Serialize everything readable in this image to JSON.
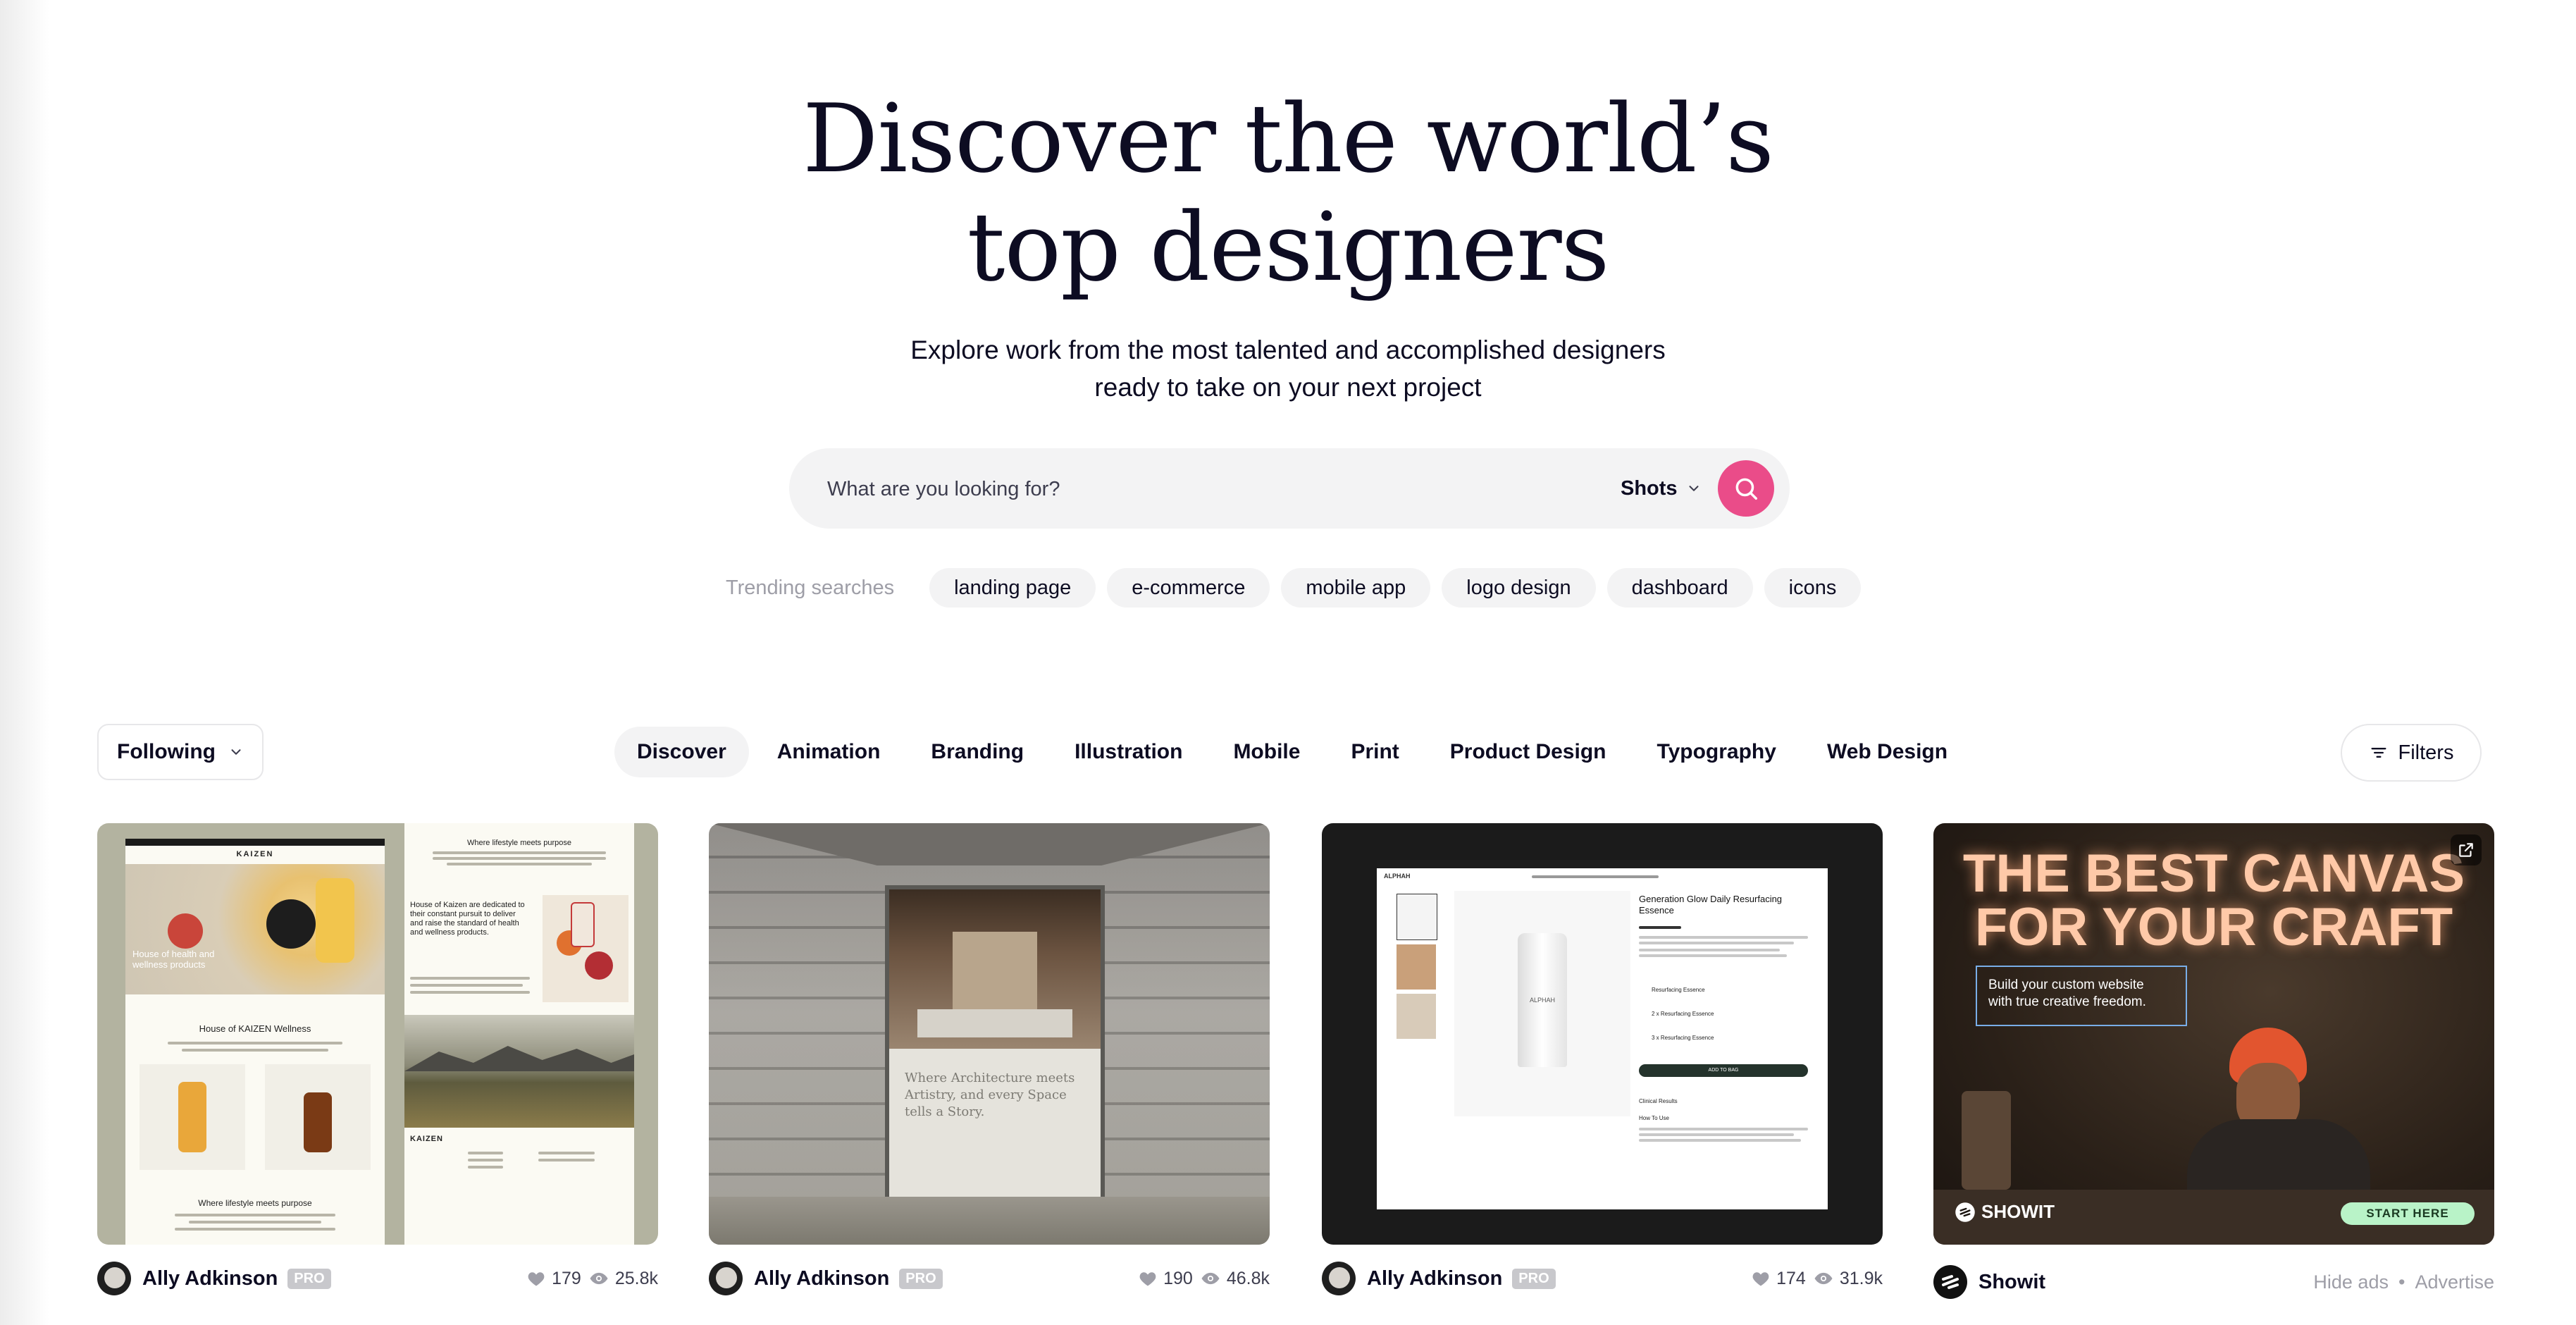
{
  "hero": {
    "title_line1": "Discover the world’s",
    "title_line2": "top designers",
    "subtitle_line1": "Explore work from the most talented and accomplished designers",
    "subtitle_line2": "ready to take on your next project"
  },
  "search": {
    "placeholder": "What are you looking for?",
    "type_label": "Shots"
  },
  "trending": {
    "label": "Trending searches",
    "chips": [
      "landing page",
      "e-commerce",
      "mobile app",
      "logo design",
      "dashboard",
      "icons"
    ]
  },
  "filter_bar": {
    "following_label": "Following",
    "categories": [
      "Discover",
      "Animation",
      "Branding",
      "Illustration",
      "Mobile",
      "Print",
      "Product Design",
      "Typography",
      "Web Design"
    ],
    "active_category": "Discover",
    "filters_label": "Filters"
  },
  "shots": [
    {
      "author": "Ally Adkinson",
      "badge": "PRO",
      "likes": "179",
      "views": "25.8k"
    },
    {
      "author": "Ally Adkinson",
      "badge": "PRO",
      "likes": "190",
      "views": "46.8k"
    },
    {
      "author": "Ally Adkinson",
      "badge": "PRO",
      "likes": "174",
      "views": "31.9k"
    }
  ],
  "card1": {
    "brand": "KAIZEN",
    "tagline": "Where lifestyle meets purpose",
    "hero_caption": "House of health and wellness products",
    "section_title": "House of KAIZEN Wellness",
    "body_heading": "House of Kaizen are dedicated to their constant pursuit to deliver and raise the standard of health and wellness products.",
    "footer_title": "Where lifestyle meets purpose",
    "footer_brand": "KAIZEN"
  },
  "card2": {
    "poster_text": "Where Architecture meets Artistry, and every Space tells a Story."
  },
  "card3": {
    "store_brand": "ALPHAH",
    "product_title": "Generation Glow Daily Resurfacing Essence",
    "bottle_label": "ALPHAH",
    "cta": "ADD TO BAG",
    "rows": [
      "Resurfacing Essence",
      "2 x Resurfacing Essence",
      "3 x Resurfacing Essence"
    ],
    "section1": "Clinical Results",
    "section2": "How To Use"
  },
  "ad": {
    "headline_line1": "THE BEST CANVAS",
    "headline_line2": "FOR YOUR CRAFT",
    "box_text_line1": "Build your custom website",
    "box_text_line2": "with true creative freedom.",
    "brand_logo_text": "SHOWIT",
    "cta": "START HERE",
    "advertiser": "Showit",
    "hide_ads": "Hide ads",
    "separator": "•",
    "advertise": "Advertise"
  },
  "colors": {
    "accent": "#ea4c89",
    "chip_bg": "#f3f3f4",
    "muted": "#9e9ea7",
    "ad_cta": "#b9f3c8",
    "ad_headline": "#ffc9a8"
  }
}
